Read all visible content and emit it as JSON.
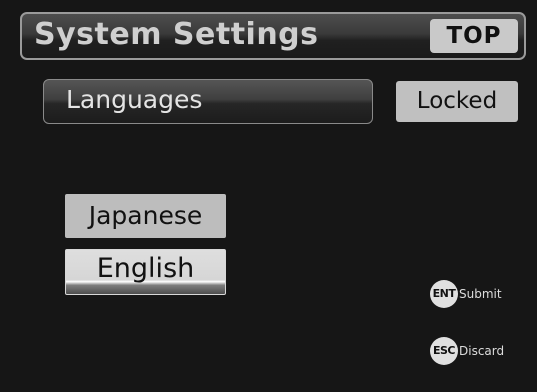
{
  "header": {
    "title": "System Settings",
    "top_button_label": "TOP"
  },
  "section": {
    "title": "Languages",
    "status": "Locked"
  },
  "languages": {
    "options": [
      {
        "label": "Japanese",
        "selected": false
      },
      {
        "label": "English",
        "selected": true
      }
    ]
  },
  "hints": {
    "enter": {
      "key": "ENT",
      "label": "Submit"
    },
    "escape": {
      "key": "ESC",
      "label": "Discard"
    }
  },
  "colors": {
    "background": "#161616",
    "button_fill": "#c0c0c0",
    "selected_highlight": "#ffffff"
  }
}
